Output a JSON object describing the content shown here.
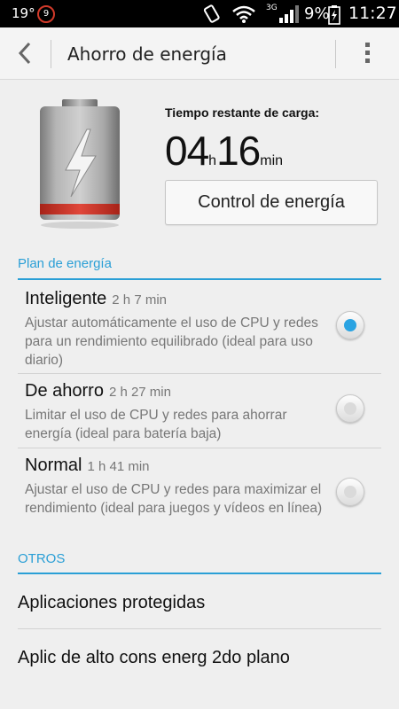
{
  "status_bar": {
    "temperature": "19°",
    "notification_count": "9",
    "network_type": "3G",
    "battery_percent": "9%",
    "time": "11:27",
    "icons": [
      "rotation-lock-icon",
      "wifi-icon",
      "signal-icon",
      "battery-charging-icon"
    ]
  },
  "action_bar": {
    "title": "Ahorro de energía",
    "icons": [
      "back-arrow-icon",
      "overflow-menu-icon"
    ]
  },
  "battery": {
    "remaining_label": "Tiempo restante de carga:",
    "hours": "04",
    "hours_unit": "h",
    "minutes": "16",
    "minutes_unit": "min",
    "icon": "battery-lightning-icon",
    "bar_color": "#d6362b"
  },
  "power_control_button": "Control de energía",
  "plan_section": {
    "header": "Plan de energía",
    "accent_color": "#2a9fd6",
    "options": [
      {
        "name": "Inteligente",
        "time": "2 h 7 min",
        "description": "Ajustar automáticamente el uso de CPU y redes para un rendimiento equilibrado (ideal para uso diario)",
        "selected": true
      },
      {
        "name": "De ahorro",
        "time": "2 h 27 min",
        "description": "Limitar el uso de CPU y redes para ahorrar energía (ideal para batería baja)",
        "selected": false
      },
      {
        "name": "Normal",
        "time": "1 h 41 min",
        "description": "Ajustar el uso de CPU y redes para maximizar el rendimiento (ideal para juegos y vídeos en línea)",
        "selected": false
      }
    ]
  },
  "others_section": {
    "header": "OTROS",
    "items": [
      "Aplicaciones protegidas",
      "Aplic de alto cons energ 2do plano"
    ]
  }
}
